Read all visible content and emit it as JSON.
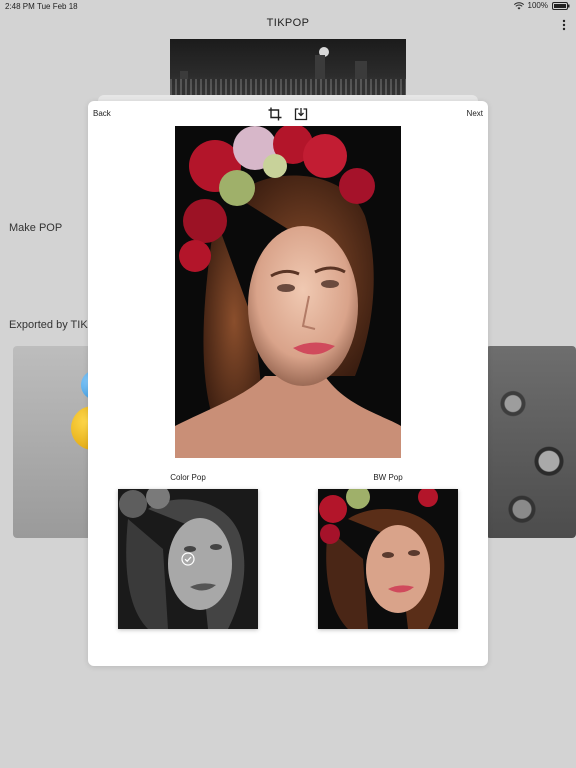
{
  "status": {
    "time": "2:48 PM",
    "date": "Tue Feb 18",
    "battery": "100%"
  },
  "app": {
    "title": "TIKPOP"
  },
  "sections": {
    "make_pop": "Make POP",
    "exported": "Exported by TIK"
  },
  "modal": {
    "back_label": "Back",
    "next_label": "Next",
    "toolbar_icons": [
      "crop-icon",
      "save-to-device-icon"
    ],
    "options": [
      {
        "label": "Color Pop",
        "selected": true,
        "style": "grayscale"
      },
      {
        "label": "BW Pop",
        "selected": false,
        "style": "color"
      }
    ]
  },
  "colors": {
    "background": "#d3d3d3",
    "modal": "#ffffff",
    "flower_red": "#b3152a",
    "lips": "#d04a5c"
  }
}
